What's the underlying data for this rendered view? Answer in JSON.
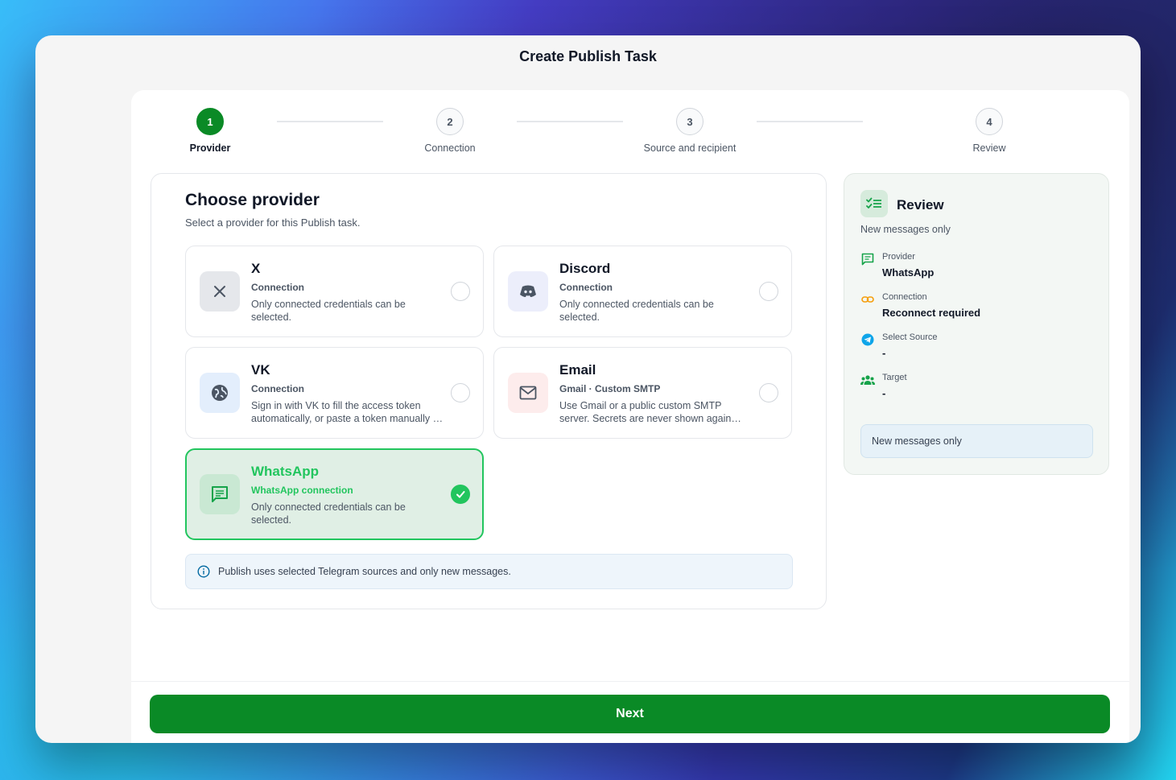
{
  "window": {
    "title": "Create Publish Task"
  },
  "stepper": {
    "steps": [
      {
        "number": "1",
        "label": "Provider"
      },
      {
        "number": "2",
        "label": "Connection"
      },
      {
        "number": "3",
        "label": "Source and recipient"
      },
      {
        "number": "4",
        "label": "Review"
      }
    ],
    "active_step": 1
  },
  "main": {
    "title": "Choose provider",
    "subtitle": "Select a provider for this Publish task.",
    "providers": [
      {
        "name": "X",
        "kind": "Connection",
        "description": "Only connected credentials can be selected.",
        "icon": "x-icon",
        "selected": false
      },
      {
        "name": "Discord",
        "kind": "Connection",
        "description": "Only connected credentials can be selected.",
        "icon": "discord-icon",
        "selected": false
      },
      {
        "name": "VK",
        "kind": "Connection",
        "description": "Sign in with VK to fill the access token automatically, or paste a token manually …",
        "icon": "globe-icon",
        "selected": false
      },
      {
        "name": "Email",
        "kind": "Gmail · Custom SMTP",
        "description": "Use Gmail or a public custom SMTP server. Secrets are never shown again aft…",
        "icon": "mail-icon",
        "selected": false
      },
      {
        "name": "WhatsApp",
        "kind": "WhatsApp connection",
        "description": "Only connected credentials can be selected.",
        "icon": "chat-icon",
        "selected": true
      }
    ],
    "info": "Publish uses selected Telegram sources and only new messages."
  },
  "review": {
    "title": "Review",
    "subtitle": "New messages only",
    "items": [
      {
        "label": "Provider",
        "value": "WhatsApp",
        "icon": "chat-icon"
      },
      {
        "label": "Connection",
        "value": "Reconnect required",
        "icon": "link-icon"
      },
      {
        "label": "Select Source",
        "value": "-",
        "icon": "telegram-icon"
      },
      {
        "label": "Target",
        "value": "-",
        "icon": "group-icon"
      }
    ],
    "note": "New messages only"
  },
  "footer": {
    "next_label": "Next"
  },
  "colors": {
    "accent": "#0a8a26",
    "selected": "#22c55e",
    "link": "#f59e0b",
    "telegram": "#0ea5e9"
  }
}
